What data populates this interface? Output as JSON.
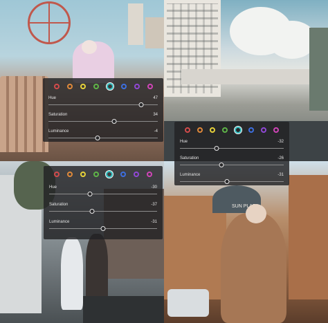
{
  "palette": [
    {
      "name": "red",
      "color": "#d34b4b"
    },
    {
      "name": "orange",
      "color": "#e0893a"
    },
    {
      "name": "yellow",
      "color": "#e7d23a"
    },
    {
      "name": "green",
      "color": "#5fb548"
    },
    {
      "name": "aqua",
      "color": "#35c4c6"
    },
    {
      "name": "blue",
      "color": "#3d6fe0"
    },
    {
      "name": "purple",
      "color": "#9048d6"
    },
    {
      "name": "magenta",
      "color": "#d045b8"
    }
  ],
  "panels": [
    {
      "selected": 4,
      "rows": [
        {
          "label": "Hue",
          "value": "47",
          "fraction": 0.85
        },
        {
          "label": "Saturation",
          "value": "34",
          "fraction": 0.6
        },
        {
          "label": "Luminance",
          "value": "-4",
          "fraction": 0.45
        }
      ]
    },
    {
      "selected": 4,
      "rows": [
        {
          "label": "Hue",
          "value": "-32",
          "fraction": 0.35
        },
        {
          "label": "Saturation",
          "value": "-26",
          "fraction": 0.4
        },
        {
          "label": "Luminance",
          "value": "-31",
          "fraction": 0.45
        }
      ]
    },
    {
      "selected": 4,
      "rows": [
        {
          "label": "Hue",
          "value": "-30",
          "fraction": 0.38
        },
        {
          "label": "Saturation",
          "value": "-37",
          "fraction": 0.4
        },
        {
          "label": "Luminance",
          "value": "-31",
          "fraction": 0.5
        }
      ]
    }
  ],
  "scenery_texts": {
    "mall_sign": "SUN PLAZA"
  }
}
